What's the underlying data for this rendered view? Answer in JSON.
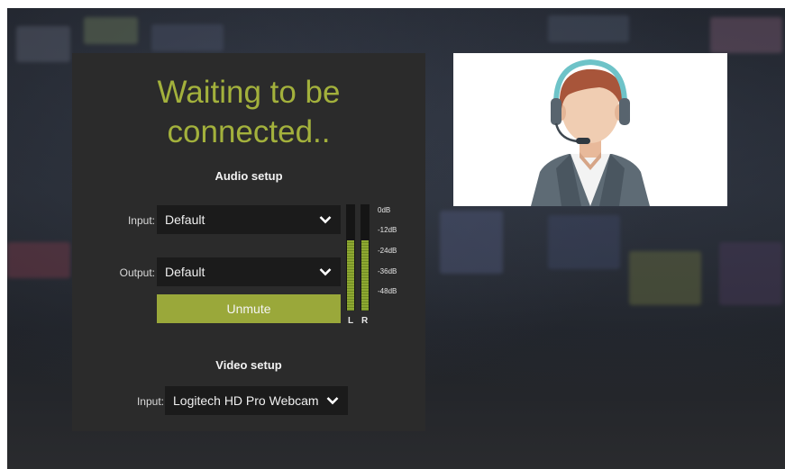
{
  "status": {
    "title_line1": "Waiting to be",
    "title_line2": "connected.."
  },
  "audio_setup": {
    "heading": "Audio setup",
    "input": {
      "label": "Input:",
      "value": "Default"
    },
    "output": {
      "label": "Output:",
      "value": "Default"
    },
    "unmute_label": "Unmute",
    "meter": {
      "scale": [
        "0dB",
        "-12dB",
        "-24dB",
        "-36dB",
        "-48dB"
      ],
      "channels": [
        {
          "label": "L",
          "level": 0.66
        },
        {
          "label": "R",
          "level": 0.66
        }
      ]
    }
  },
  "video_setup": {
    "heading": "Video setup",
    "input": {
      "label": "Input:",
      "value": "Logitech HD Pro Webcam C"
    }
  },
  "colors": {
    "accent": "#a3b13c",
    "button": "#9aa83a",
    "panel": "#2b2b2b",
    "field": "#1b1b1b"
  },
  "icons": {
    "dropdown": "chevron-down-icon",
    "preview": "support-agent-headset-illustration"
  }
}
